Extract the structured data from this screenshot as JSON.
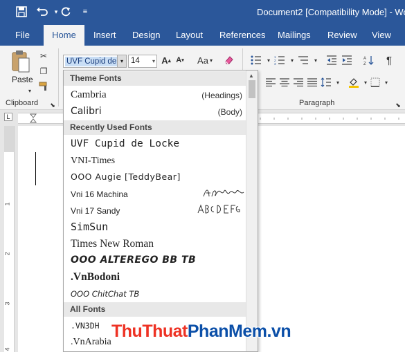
{
  "titlebar": {
    "document_title": "Document2 [Compatibility Mode]  -  Wo",
    "icons": [
      "save-icon",
      "undo-icon",
      "redo-icon",
      "customize-qat-icon"
    ]
  },
  "tabs": [
    {
      "label": "File"
    },
    {
      "label": "Home"
    },
    {
      "label": "Insert"
    },
    {
      "label": "Design"
    },
    {
      "label": "Layout"
    },
    {
      "label": "References"
    },
    {
      "label": "Mailings"
    },
    {
      "label": "Review"
    },
    {
      "label": "View"
    }
  ],
  "ribbon": {
    "paste_label": "Paste",
    "clipboard_label": "Clipboard",
    "paragraph_label": "Paragraph",
    "font_name": "UVF Cupid de",
    "font_size": "14",
    "case_label": "Aa"
  },
  "font_dropdown": {
    "theme_header": "Theme Fonts",
    "theme_fonts": [
      {
        "name": "Cambria",
        "tag": "(Headings)"
      },
      {
        "name": "Calibri",
        "tag": "(Body)"
      }
    ],
    "recent_header": "Recently Used Fonts",
    "recent_fonts": [
      "UVF Cupid de Locke",
      "VNI-Times",
      "OOO Augie [TeddyBear]",
      "Vni 16 Machina",
      "Vni 17 Sandy",
      "SimSun",
      "Times New Roman",
      "OOO ALTEREGO BB TB",
      ".VnBodoni",
      "OOO ChitChat TB"
    ],
    "all_header": "All Fonts",
    "all_fonts": [
      ".VN3DH",
      ".VnArabia"
    ]
  },
  "watermark": {
    "part1": "Thu",
    "part2": "Thuat",
    "part3": "PhanMem",
    "part4": ".vn"
  },
  "colors": {
    "titlebar": "#2b579a",
    "ribbon": "#f3f3f3",
    "watermark_red": "#ee3224",
    "watermark_blue": "#0b4fa8"
  }
}
